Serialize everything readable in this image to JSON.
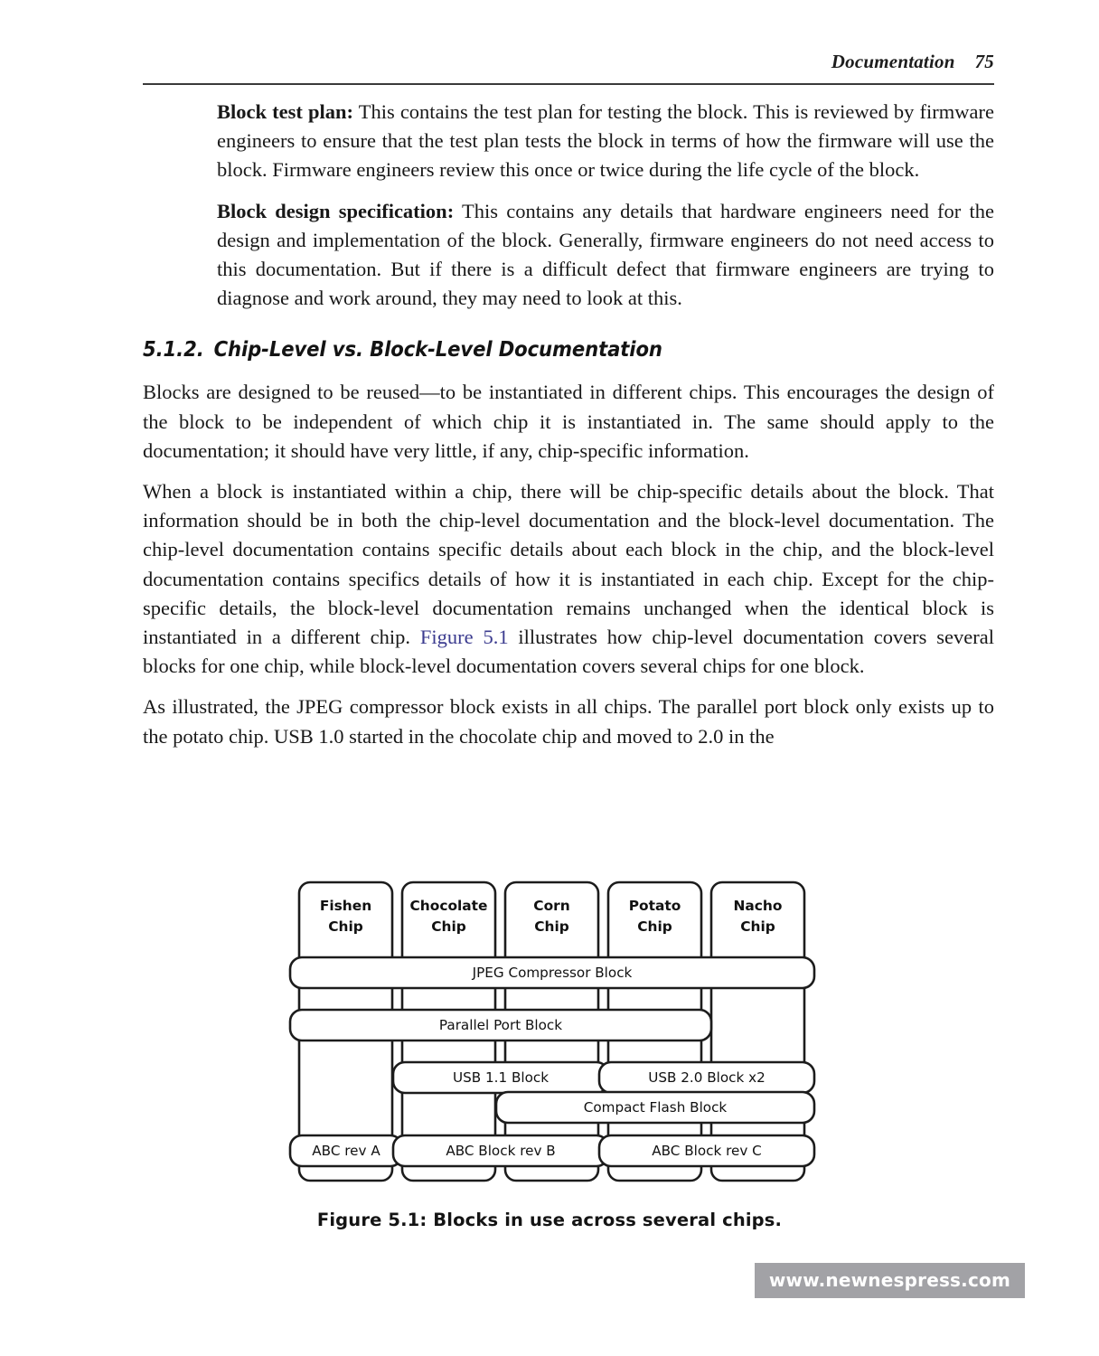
{
  "header": {
    "running_title": "Documentation",
    "page_number": "75"
  },
  "body": {
    "para_block_test_plan": {
      "lead": "Block test plan:",
      "text": " This contains the test plan for testing the block. This is reviewed by firmware engineers to ensure that the test plan tests the block in terms of how the firmware will use the block. Firmware engineers review this once or twice during the life cycle of the block."
    },
    "para_block_design_spec": {
      "lead": "Block design specification:",
      "text": " This contains any details that hardware engineers need for the design and implementation of the block. Generally, firmware engineers do not need access to this documentation. But if there is a difficult defect that firmware engineers are trying to diagnose and work around, they may need to look at this."
    },
    "section_heading": {
      "number": "5.1.2.",
      "title": "Chip-Level vs. Block-Level Documentation"
    },
    "para_blocks_reused": "Blocks are designed to be reused—to be instantiated in different chips. This encourages the design of the block to be independent of which chip it is instantiated in. The same should apply to the documentation; it should have very little, if any, chip-specific information.",
    "para_chip_specific_a": "When a block is instantiated within a chip, there will be chip-specific details about the block. That information should be in both the chip-level documentation and the block-level documentation. The chip-level documentation contains specific details about each block in the chip, and the block-level documentation contains specifics details of how it is instantiated in each chip. Except for the chip-specific details, the block-level documentation remains unchanged when the identical block is instantiated in a different chip. ",
    "para_chip_specific_xref": "Figure 5.1",
    "para_chip_specific_b": " illustrates how chip-level documentation covers several blocks for one chip, while block-level documentation covers several chips for one block.",
    "para_as_illustrated": "As illustrated, the JPEG compressor block exists in all chips. The parallel port block only exists up to the potato chip. USB 1.0 started in the chocolate chip and moved to 2.0 in the"
  },
  "figure": {
    "caption": "Figure 5.1: Blocks in use across several chips.",
    "chips": [
      {
        "line1": "Fishen",
        "line2": "Chip"
      },
      {
        "line1": "Chocolate",
        "line2": "Chip"
      },
      {
        "line1": "Corn",
        "line2": "Chip"
      },
      {
        "line1": "Potato",
        "line2": "Chip"
      },
      {
        "line1": "Nacho",
        "line2": "Chip"
      }
    ],
    "blocks": [
      {
        "label": "JPEG Compressor Block",
        "from_chip": 0,
        "to_chip": 4
      },
      {
        "label": "Parallel Port Block",
        "from_chip": 0,
        "to_chip": 3
      },
      {
        "label": "USB 1.1 Block",
        "from_chip": 1,
        "to_chip": 2
      },
      {
        "label": "USB 2.0 Block x2",
        "from_chip": 3,
        "to_chip": 4
      },
      {
        "label": "Compact Flash Block",
        "from_chip": 2,
        "to_chip": 4
      },
      {
        "label": "ABC rev A",
        "from_chip": 0,
        "to_chip": 0
      },
      {
        "label": "ABC Block rev B",
        "from_chip": 1,
        "to_chip": 2
      },
      {
        "label": "ABC Block rev C",
        "from_chip": 3,
        "to_chip": 4
      }
    ]
  },
  "footer": {
    "url": "www.newnespress.com",
    "background_color": "#a2a2a6",
    "text_color": "#ffffff"
  },
  "colors": {
    "text": "#181818",
    "xref_link": "#3b3b8f",
    "rule": "#3a3a3a",
    "diagram_stroke": "#1c1c1c"
  }
}
